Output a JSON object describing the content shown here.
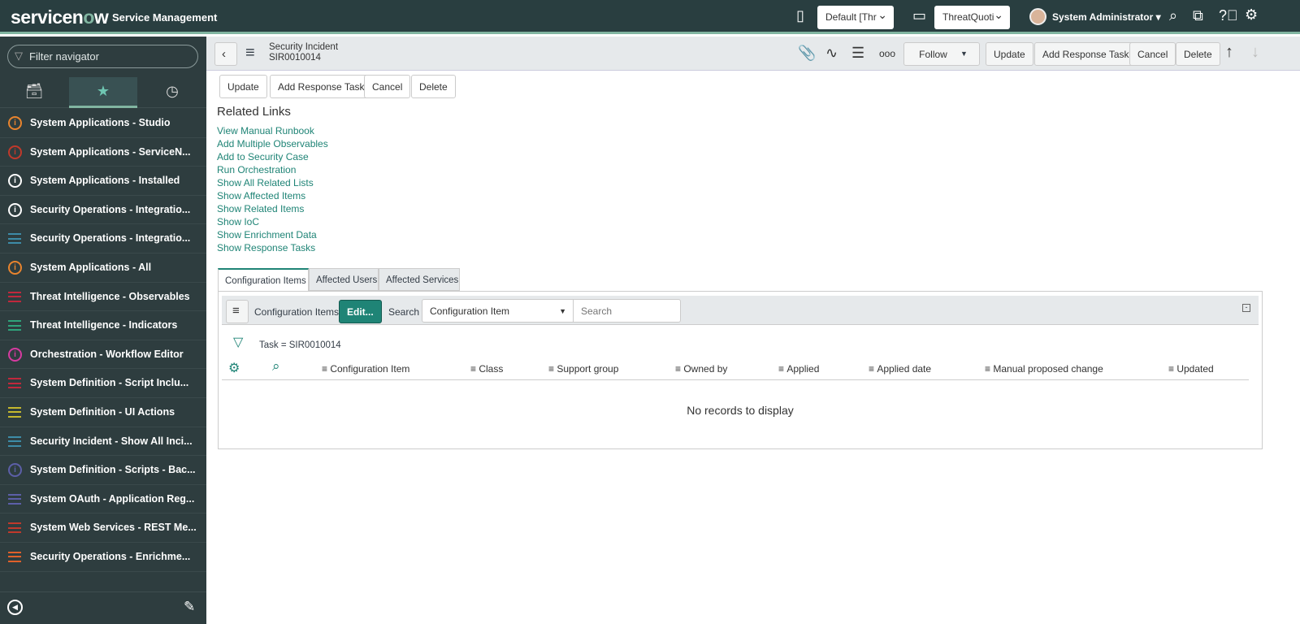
{
  "header": {
    "brand_main": "servicen",
    "brand_o": "o",
    "brand_end": "w",
    "app_name": "Service Management",
    "update_set": "Default [Thr",
    "application": "ThreatQuoti",
    "user": "System Administrator"
  },
  "sidebar": {
    "filter_placeholder": "Filter navigator",
    "items": [
      {
        "label": "System Applications - Studio",
        "icon": "info",
        "color": "#e8842e"
      },
      {
        "label": "System Applications - ServiceN...",
        "icon": "info",
        "color": "#c0392b"
      },
      {
        "label": "System Applications - Installed",
        "icon": "info",
        "color": "#ffffff"
      },
      {
        "label": "Security Operations - Integratio...",
        "icon": "info",
        "color": "#ffffff"
      },
      {
        "label": "Security Operations - Integratio...",
        "icon": "list",
        "color": "#3d8ca8"
      },
      {
        "label": "System Applications - All",
        "icon": "info",
        "color": "#e8842e"
      },
      {
        "label": "Threat Intelligence - Observables",
        "icon": "list",
        "color": "#c0283c"
      },
      {
        "label": "Threat Intelligence - Indicators",
        "icon": "list",
        "color": "#2fa37b"
      },
      {
        "label": "Orchestration - Workflow Editor",
        "icon": "info",
        "color": "#d63ba0"
      },
      {
        "label": "System Definition - Script Inclu...",
        "icon": "list",
        "color": "#c0283c"
      },
      {
        "label": "System Definition - UI Actions",
        "icon": "list",
        "color": "#c5b82e"
      },
      {
        "label": "Security Incident - Show All Inci...",
        "icon": "list",
        "color": "#3d8ca8"
      },
      {
        "label": "System Definition - Scripts - Bac...",
        "icon": "info",
        "color": "#5c5fa8"
      },
      {
        "label": "System OAuth - Application Reg...",
        "icon": "list",
        "color": "#5c5fa8"
      },
      {
        "label": "System Web Services - REST Me...",
        "icon": "list",
        "color": "#c0392b"
      },
      {
        "label": "Security Operations - Enrichme...",
        "icon": "list",
        "color": "#e0602a"
      }
    ]
  },
  "record": {
    "table": "Security Incident",
    "number": "SIR0010014",
    "follow": "Follow",
    "update": "Update",
    "add_task": "Add Response Task",
    "cancel": "Cancel",
    "delete": "Delete"
  },
  "related": {
    "title": "Related Links",
    "links": [
      "View Manual Runbook",
      "Add Multiple Observables",
      "Add to Security Case",
      "Run Orchestration",
      "Show All Related Lists",
      "Show Affected Items",
      "Show Related Items",
      "Show IoC",
      "Show Enrichment Data",
      "Show Response Tasks"
    ]
  },
  "tabs": [
    "Configuration Items",
    "Affected Users",
    "Affected Services"
  ],
  "list": {
    "title": "Configuration Items",
    "edit": "Edit...",
    "search_label": "Search",
    "search_field": "Configuration Item",
    "search_placeholder": "Search",
    "filter": "Task = SIR0010014",
    "columns": [
      "Configuration Item",
      "Class",
      "Support group",
      "Owned by",
      "Applied",
      "Applied date",
      "Manual proposed change",
      "Updated"
    ],
    "empty": "No records to display"
  }
}
